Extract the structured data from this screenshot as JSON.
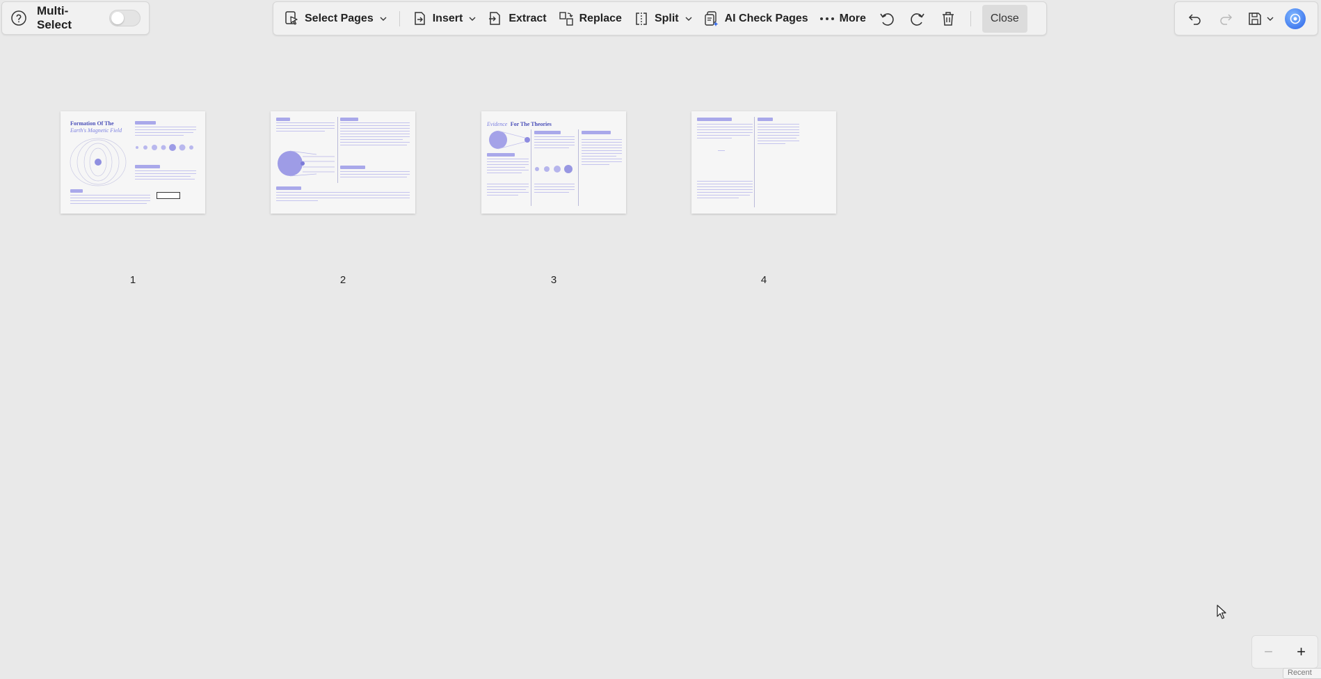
{
  "left": {
    "multi_select_label": "Multi-Select"
  },
  "toolbar": {
    "select_pages": "Select Pages",
    "insert": "Insert",
    "extract": "Extract",
    "replace": "Replace",
    "split": "Split",
    "ai_check_pages": "AI Check Pages",
    "more": "More",
    "close": "Close"
  },
  "pages": [
    {
      "number": "1",
      "title": "Formation Of The",
      "subtitle": "Earth's Magnetic Field"
    },
    {
      "number": "2"
    },
    {
      "number": "3",
      "title_accent": "Evidence",
      "title_rest": "For The Theories"
    },
    {
      "number": "4"
    }
  ],
  "bottom": {
    "recent_label": "Recent"
  },
  "colors": {
    "background": "#e9e9e9",
    "accent": "#2b63e8",
    "thumb_accent": "#4a4fb8"
  },
  "icons": [
    "help-icon",
    "select-pages-icon",
    "insert-icon",
    "extract-icon",
    "replace-icon",
    "split-icon",
    "ai-check-icon",
    "more-icon",
    "rotate-left-icon",
    "rotate-right-icon",
    "trash-icon",
    "undo-icon",
    "redo-icon",
    "save-icon",
    "assistant-icon"
  ]
}
